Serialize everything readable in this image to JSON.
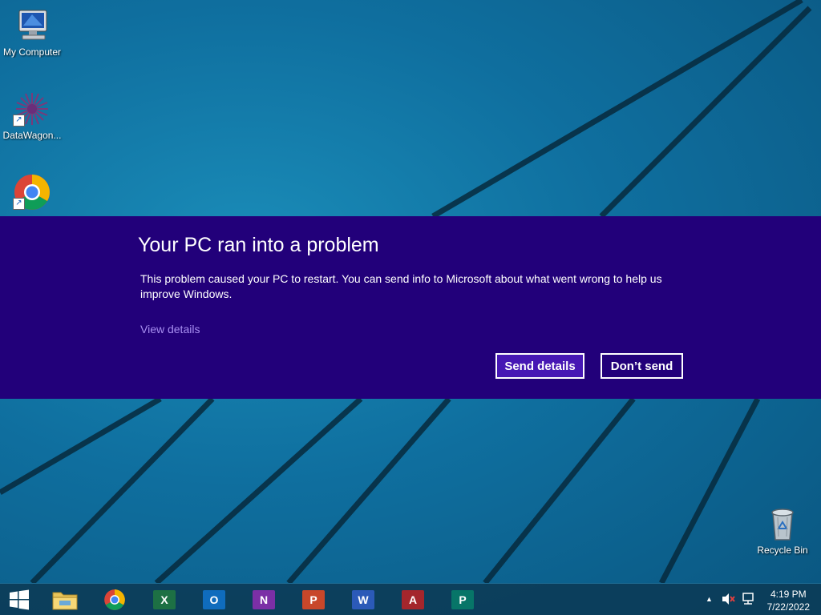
{
  "desktop": {
    "icons": [
      {
        "label": "My Computer",
        "icon": "my-computer-icon"
      },
      {
        "label": "DataWagon...",
        "icon": "datawagon-icon"
      },
      {
        "label": "",
        "icon": "chrome-icon"
      },
      {
        "label": "Recycle Bin",
        "icon": "recycle-bin-icon"
      }
    ]
  },
  "error_dialog": {
    "title": "Your PC ran into a problem",
    "message": "This problem caused your PC to restart. You can send info to Microsoft about what went wrong to help us improve Windows.",
    "view_details": "View details",
    "send_label": "Send details",
    "dont_send_label": "Don’t send",
    "colors": {
      "banner": "#22007a",
      "send_button": "#4617b4",
      "link": "#a78ef0"
    }
  },
  "taskbar": {
    "start_icon": "windows-start-icon",
    "apps": [
      {
        "name": "File Explorer",
        "icon": "file-explorer-icon",
        "letter": ""
      },
      {
        "name": "Google Chrome",
        "icon": "chrome-icon",
        "letter": ""
      },
      {
        "name": "Excel",
        "icon": "excel-icon",
        "letter": "X",
        "color": "#1d7044"
      },
      {
        "name": "Outlook",
        "icon": "outlook-icon",
        "letter": "O",
        "color": "#0f6cbd"
      },
      {
        "name": "OneNote",
        "icon": "onenote-icon",
        "letter": "N",
        "color": "#7b2fa6"
      },
      {
        "name": "PowerPoint",
        "icon": "powerpoint-icon",
        "letter": "P",
        "color": "#c8472a"
      },
      {
        "name": "Word",
        "icon": "word-icon",
        "letter": "W",
        "color": "#2b5ab8"
      },
      {
        "name": "Access",
        "icon": "access-icon",
        "letter": "A",
        "color": "#a4262c"
      },
      {
        "name": "Publisher",
        "icon": "publisher-icon",
        "letter": "P",
        "color": "#077568"
      }
    ],
    "tray": {
      "icons": [
        "chevron-up-icon",
        "volume-muted-icon",
        "network-icon"
      ],
      "time": "4:19 PM",
      "date": "7/22/2022"
    }
  }
}
